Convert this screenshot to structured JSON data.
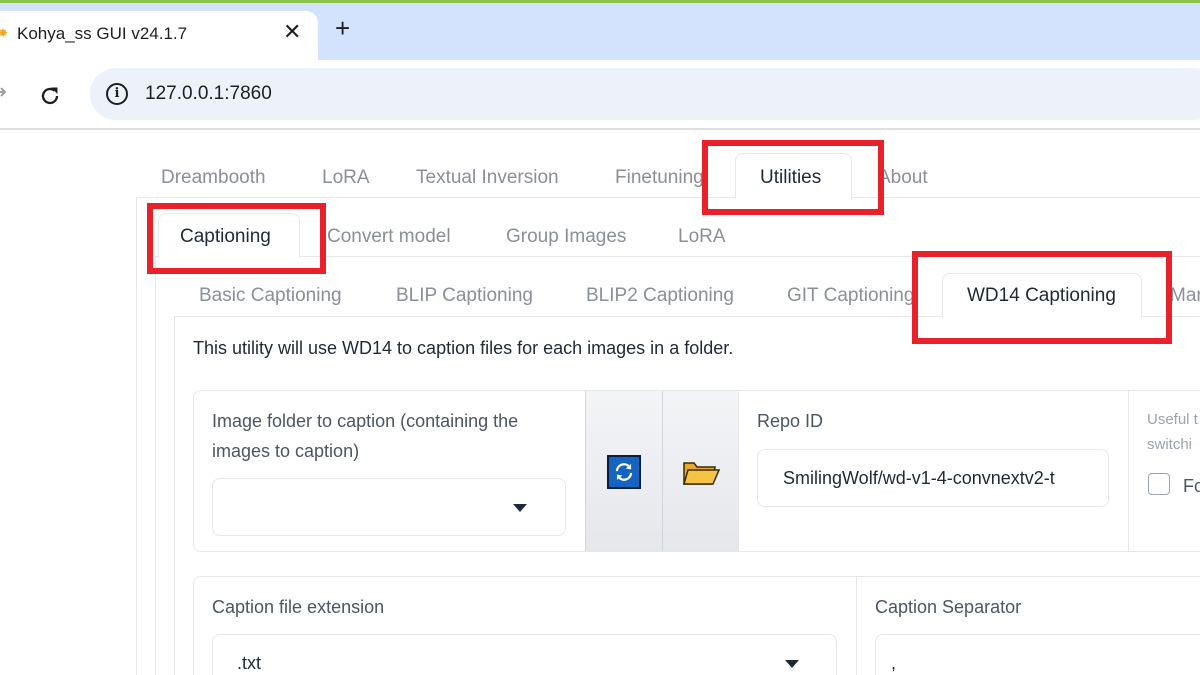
{
  "browser": {
    "tab_title": "Kohya_ss GUI v24.1.7",
    "new_tab": "+",
    "close": "✕",
    "url": "127.0.0.1:7860"
  },
  "main_tabs": [
    {
      "label": "Dreambooth"
    },
    {
      "label": "LoRA"
    },
    {
      "label": "Textual Inversion"
    },
    {
      "label": "Finetuning"
    },
    {
      "label": "Utilities",
      "selected": true
    },
    {
      "label": "About"
    }
  ],
  "utility_tabs": [
    {
      "label": "Captioning",
      "selected": true
    },
    {
      "label": "Convert model"
    },
    {
      "label": "Group Images"
    },
    {
      "label": "LoRA"
    }
  ],
  "caption_tabs": [
    {
      "label": "Basic Captioning"
    },
    {
      "label": "BLIP Captioning"
    },
    {
      "label": "BLIP2 Captioning"
    },
    {
      "label": "GIT Captioning"
    },
    {
      "label": "WD14 Captioning",
      "selected": true
    },
    {
      "label": "Mar"
    }
  ],
  "description": "This utility will use WD14 to caption files for each images in a folder.",
  "image_folder": {
    "label_line1": "Image folder to caption (containing the",
    "label_line2": "images to caption)",
    "value": ""
  },
  "repo": {
    "label": "Repo ID",
    "value": "SmilingWolf/wd-v1-4-convnextv2-t"
  },
  "side_option": {
    "line1": "Useful t",
    "line2": "switchi",
    "checkbox_label": "Fo"
  },
  "caption_extension": {
    "label": "Caption file extension",
    "value": ".txt"
  },
  "caption_separator": {
    "label": "Caption Separator",
    "value": ","
  },
  "colors": {
    "highlight": "#e8212b",
    "refresh_icon": "#1565c0",
    "folder_icon": "#f6c443"
  },
  "icons": [
    "refresh-icon",
    "folder-icon",
    "info-icon",
    "reload-icon",
    "caret-down-icon"
  ]
}
